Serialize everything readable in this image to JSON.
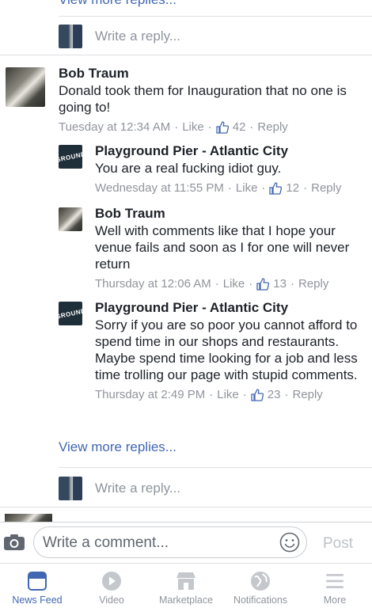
{
  "top": {
    "view_more_cut": "View more replies..."
  },
  "reply_box_placeholder": "Write a reply...",
  "comments": [
    {
      "name": "Bob Traum",
      "text": "Donald took them for Inauguration that no one is going to!",
      "time": "Tuesday at 12:34 AM",
      "like": "Like",
      "likes": "42",
      "reply": "Reply"
    },
    {
      "name": "Playground Pier - Atlantic City",
      "text": "You are a real fucking idiot guy.",
      "time": "Wednesday at 11:55 PM",
      "like": "Like",
      "likes": "12",
      "reply": "Reply"
    },
    {
      "name": "Bob Traum",
      "text": "Well with comments like that I hope your venue fails and soon as I for one will never return",
      "time": "Thursday at 12:06 AM",
      "like": "Like",
      "likes": "13",
      "reply": "Reply"
    },
    {
      "name": "Playground Pier - Atlantic City",
      "text": "Sorry if you are so poor you cannot afford to spend time in our shops and restaurants. Maybe spend time looking for a job and less time trolling our page with stupid comments.",
      "time": "Thursday at 2:49 PM",
      "like": "Like",
      "likes": "23",
      "reply": "Reply"
    }
  ],
  "logo_text": "GROUND",
  "view_more": "View more replies...",
  "composer": {
    "placeholder": "Write a comment...",
    "post": "Post"
  },
  "tabs": [
    {
      "label": "News Feed",
      "icon": "news-feed-icon",
      "active": true
    },
    {
      "label": "Video",
      "icon": "video-icon"
    },
    {
      "label": "Marketplace",
      "icon": "marketplace-icon"
    },
    {
      "label": "Notifications",
      "icon": "notifications-icon"
    },
    {
      "label": "More",
      "icon": "more-icon"
    }
  ],
  "colors": {
    "link": "#4267b2",
    "meta": "#90949c",
    "text": "#1d2129",
    "inactive_icon": "#c4c7cc"
  }
}
